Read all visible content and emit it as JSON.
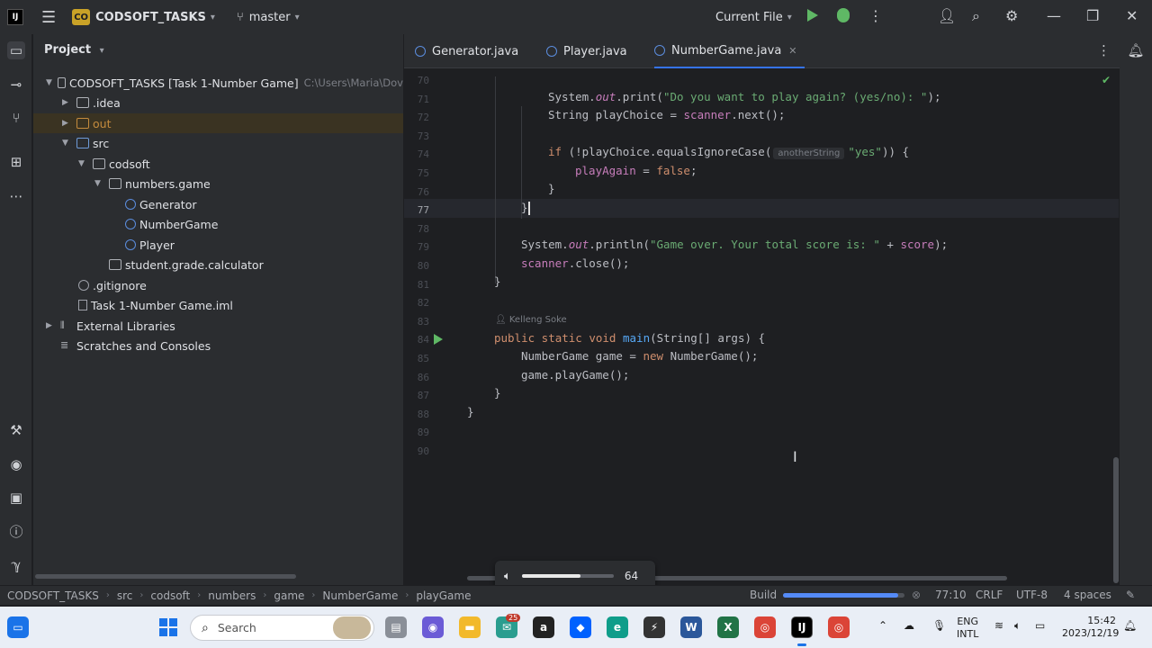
{
  "titlebar": {
    "app_badge": "CO",
    "project_name": "CODSOFT_TASKS",
    "branch": "master",
    "run_config": "Current File"
  },
  "project_panel": {
    "header": "Project",
    "tree": [
      {
        "label": "CODSOFT_TASKS [Task 1-Number Game]",
        "path": "C:\\Users\\Maria\\Dov",
        "depth": 0,
        "icon": "folder-icon",
        "expanded": true
      },
      {
        "label": ".idea",
        "depth": 1,
        "icon": "folder-icon",
        "expanded": false
      },
      {
        "label": "out",
        "depth": 1,
        "icon": "folder-orange-icon",
        "expanded": false,
        "selected": true
      },
      {
        "label": "src",
        "depth": 1,
        "icon": "folder-blue-icon",
        "expanded": true
      },
      {
        "label": "codsoft",
        "depth": 2,
        "icon": "package-icon",
        "expanded": true
      },
      {
        "label": "numbers.game",
        "depth": 3,
        "icon": "package-icon",
        "expanded": true
      },
      {
        "label": "Generator",
        "depth": 4,
        "icon": "class-icon"
      },
      {
        "label": "NumberGame",
        "depth": 4,
        "icon": "class-icon"
      },
      {
        "label": "Player",
        "depth": 4,
        "icon": "class-icon"
      },
      {
        "label": "student.grade.calculator",
        "depth": 3,
        "icon": "package-icon"
      },
      {
        "label": ".gitignore",
        "depth": 2,
        "icon": "gitignore-icon"
      },
      {
        "label": "Task 1-Number Game.iml",
        "depth": 2,
        "icon": "iml-file-icon"
      },
      {
        "label": "External Libraries",
        "depth": 0,
        "icon": "libraries-icon",
        "expanded": false
      },
      {
        "label": "Scratches and Consoles",
        "depth": 0,
        "icon": "scratches-icon"
      }
    ]
  },
  "editor": {
    "tabs": [
      {
        "label": "Generator.java",
        "active": false
      },
      {
        "label": "Player.java",
        "active": false
      },
      {
        "label": "NumberGame.java",
        "active": true
      }
    ],
    "line_numbers": [
      "70",
      "71",
      "72",
      "73",
      "74",
      "75",
      "76",
      "77",
      "78",
      "79",
      "80",
      "81",
      "82",
      "83",
      "84",
      "85",
      "86",
      "87",
      "88",
      "89",
      "90"
    ],
    "current_line": "77",
    "author_hint": "Kelleng Soke",
    "param_hint": "anotherString"
  },
  "statusbar": {
    "breadcrumbs": [
      "CODSOFT_TASKS",
      "src",
      "codsoft",
      "numbers",
      "game",
      "NumberGame",
      "playGame"
    ],
    "build_label": "Build",
    "build_progress": 0.95,
    "cursor_pos": "77:10",
    "line_ending": "CRLF",
    "encoding": "UTF-8",
    "indent": "4 spaces"
  },
  "volume_overlay": {
    "level": "64",
    "level_fraction": 0.64
  },
  "taskbar": {
    "search_placeholder": "Search",
    "mail_badge": "25",
    "lang_line1": "ENG",
    "lang_line2": "INTL",
    "time": "15:42",
    "date": "2023/12/19"
  },
  "colors": {
    "accent": "#3574f0",
    "run_green": "#5fb865",
    "keyword": "#cf8e6d",
    "string": "#6aab73",
    "field": "#c77dbb",
    "project_badge": "#c9a227"
  }
}
